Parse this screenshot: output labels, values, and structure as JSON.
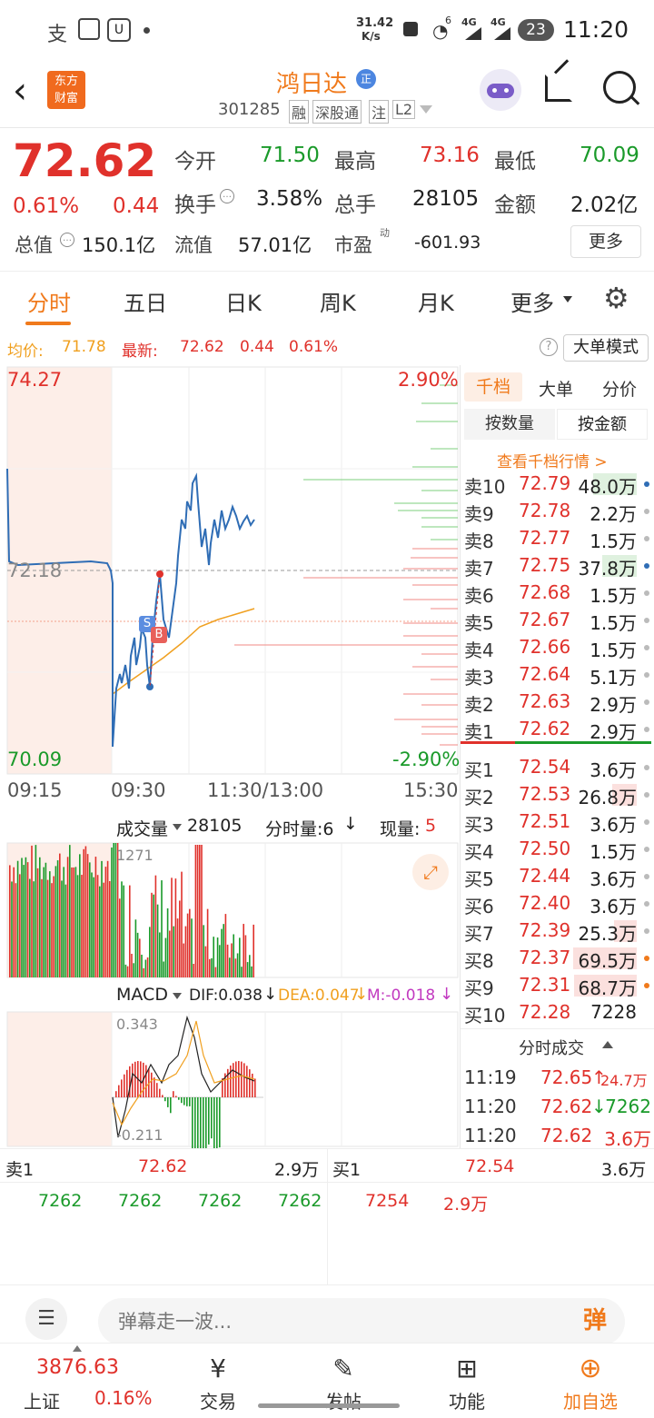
{
  "status_bar": {
    "net_speed_value": "31.42",
    "net_speed_unit": "K/s",
    "signal_left": "4G",
    "signal_right": "4G",
    "battery": "23",
    "time": "11:20",
    "wifi_badge": "6"
  },
  "header": {
    "brand_line1": "东方",
    "brand_line2": "财富",
    "stock_name": "鸿日达",
    "badge_char": "正",
    "code": "301285",
    "tags": [
      "融",
      "深股通",
      "注",
      "L2"
    ]
  },
  "quote": {
    "price": "72.62",
    "pct": "0.61%",
    "chg": "0.44",
    "open_label": "今开",
    "open": "71.50",
    "high_label": "最高",
    "high": "73.16",
    "low_label": "最低",
    "low": "70.09",
    "turnover_label": "换手",
    "turnover": "3.58%",
    "hands_label": "总手",
    "hands": "28105",
    "amount_label": "金额",
    "amount": "2.02亿",
    "mcap_label": "总值",
    "mcap": "150.1亿",
    "float_label": "流值",
    "float": "57.01亿",
    "pe_label": "市盈",
    "pe_sup": "动",
    "pe": "-601.93",
    "more": "更多"
  },
  "tabs": [
    "分时",
    "五日",
    "日K",
    "周K",
    "月K",
    "更多"
  ],
  "info_line": {
    "avg_label": "均价:",
    "avg": "71.78",
    "last_label": "最新:",
    "last": "72.62",
    "chg": "0.44",
    "pct": "0.61%",
    "bigorder_mode": "大单模式"
  },
  "chart": {
    "y_top": "74.27",
    "y_mid": "72.18",
    "y_bottom": "70.09",
    "pct_top": "2.90%",
    "pct_bottom": "-2.90%",
    "x_labels": [
      "09:15",
      "09:30",
      "11:30/13:00",
      "15:30"
    ],
    "volume_selector": "成交量",
    "volume_total": "28105",
    "time_volume_label": "分时量:6",
    "current_volume_label": "现量:",
    "current_volume": "5",
    "volume_max": "1271",
    "macd_selector": "MACD",
    "dif": "DIF:0.038",
    "dea": "DEA:0.047",
    "m": "M:-0.018",
    "macd_max": "0.343",
    "macd_min": "-0.211",
    "marker_s": "S",
    "marker_b": "B"
  },
  "book": {
    "tabs": [
      "千档",
      "大单",
      "分价"
    ],
    "subtabs": [
      "按数量",
      "按金额"
    ],
    "view_link": "查看千档行情 >",
    "sells": [
      {
        "label": "卖10",
        "price": "72.79",
        "vol": "48.0万"
      },
      {
        "label": "卖9",
        "price": "72.78",
        "vol": "2.2万"
      },
      {
        "label": "卖8",
        "price": "72.77",
        "vol": "1.5万"
      },
      {
        "label": "卖7",
        "price": "72.75",
        "vol": "37.8万"
      },
      {
        "label": "卖6",
        "price": "72.68",
        "vol": "1.5万"
      },
      {
        "label": "卖5",
        "price": "72.67",
        "vol": "1.5万"
      },
      {
        "label": "卖4",
        "price": "72.66",
        "vol": "1.5万"
      },
      {
        "label": "卖3",
        "price": "72.64",
        "vol": "5.1万"
      },
      {
        "label": "卖2",
        "price": "72.63",
        "vol": "2.9万"
      },
      {
        "label": "卖1",
        "price": "72.62",
        "vol": "2.9万"
      }
    ],
    "buys": [
      {
        "label": "买1",
        "price": "72.54",
        "vol": "3.6万"
      },
      {
        "label": "买2",
        "price": "72.53",
        "vol": "26.8万"
      },
      {
        "label": "买3",
        "price": "72.51",
        "vol": "3.6万"
      },
      {
        "label": "买4",
        "price": "72.50",
        "vol": "1.5万"
      },
      {
        "label": "买5",
        "price": "72.44",
        "vol": "3.6万"
      },
      {
        "label": "买6",
        "price": "72.40",
        "vol": "3.6万"
      },
      {
        "label": "买7",
        "price": "72.39",
        "vol": "25.3万"
      },
      {
        "label": "买8",
        "price": "72.37",
        "vol": "69.5万"
      },
      {
        "label": "买9",
        "price": "72.31",
        "vol": "68.7万"
      },
      {
        "label": "买10",
        "price": "72.28",
        "vol": "7228"
      }
    ],
    "trades_title": "分时成交",
    "trades": [
      {
        "time": "11:19",
        "price": "72.65",
        "arrow": "↑",
        "vol": "24.7万"
      },
      {
        "time": "11:20",
        "price": "72.62",
        "arrow": "↓",
        "vol": "7262"
      },
      {
        "time": "11:20",
        "price": "72.62",
        "arrow": "",
        "vol": "3.6万"
      }
    ]
  },
  "ticks": {
    "sell1_label": "卖1",
    "sell1_price": "72.62",
    "sell1_vol": "2.9万",
    "buy1_label": "买1",
    "buy1_price": "72.54",
    "buy1_vol": "3.6万",
    "left_values": [
      "7262",
      "7262",
      "7262",
      "7262"
    ],
    "right_values": [
      "7254",
      "2.9万"
    ]
  },
  "danmu": {
    "placeholder": "弹幕走一波...",
    "button": "弹"
  },
  "bottom": {
    "index_value": "3876.63",
    "index_name": "上证",
    "index_pct": "0.16%",
    "nav": [
      "交易",
      "发帖",
      "功能",
      "加自选"
    ]
  },
  "colors": {
    "up": "#e0312b",
    "down": "#1a9a2a",
    "accent": "#f07a1c",
    "price_line": "#2f6db5",
    "avg_line": "#f0a020"
  }
}
